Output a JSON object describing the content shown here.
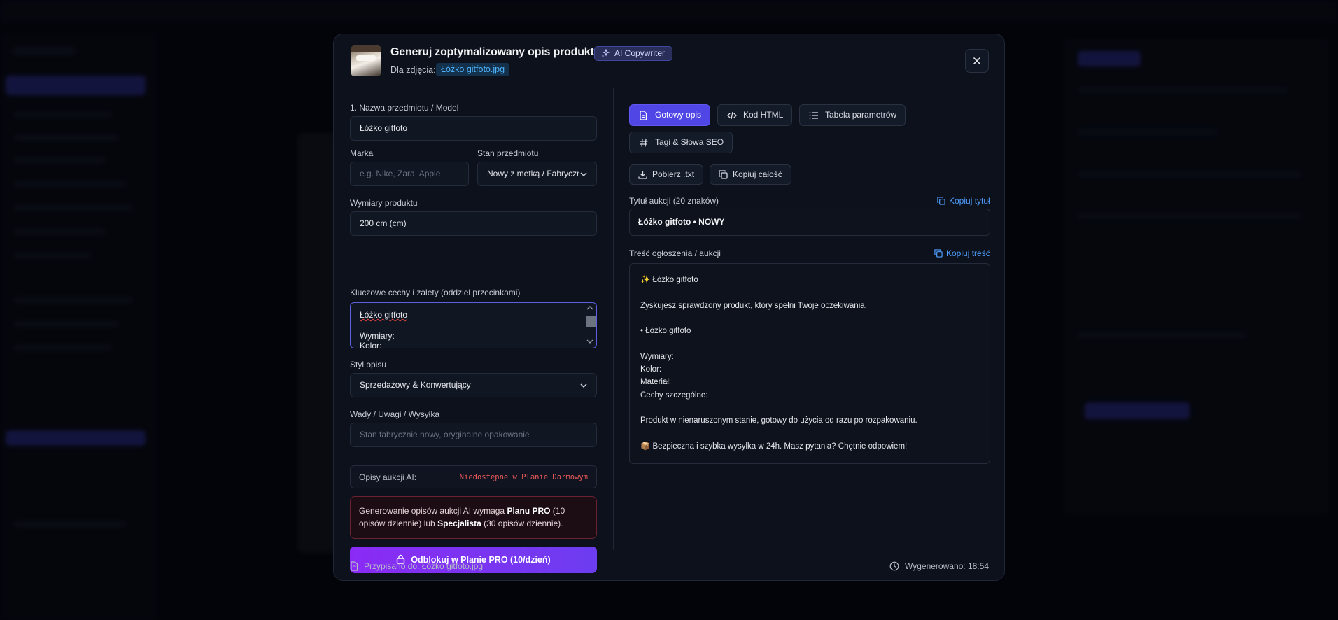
{
  "modal": {
    "title": "Generuj zoptymalizowany opis produktu",
    "badge": "AI Copywriter",
    "for_label": "Dla zdjęcia:",
    "file_name": "Łóżko gitfoto.jpg"
  },
  "form": {
    "name_label": "1. Nazwa przedmiotu / Model",
    "name_value": "Łóżko gitfoto",
    "brand_label": "Marka",
    "brand_placeholder": "e.g. Nike, Zara, Apple",
    "condition_label": "Stan przedmiotu",
    "condition_value": "Nowy z metką / Fabrycznie",
    "dims_label": "Wymiary produktu",
    "dims_value": "200 cm (cm)",
    "features_label": "Kluczowe cechy i zalety (oddziel przecinkami)",
    "features_line1": "Łóżko gitfoto",
    "features_line2": "Wymiary:",
    "features_line3": "Kolor:",
    "style_label": "Styl opisu",
    "style_value": "Sprzedażowy & Konwertujący",
    "defects_label": "Wady / Uwagi / Wysyłka",
    "defects_placeholder": "Stan fabrycznie nowy, oryginalne opakowanie",
    "ai_key": "Opisy aukcji AI:",
    "ai_value": "Niedostępne w Planie Darmowym",
    "warn_pre": "Generowanie opisów aukcji AI wymaga ",
    "warn_plan_pro": "Planu PRO",
    "warn_mid": " (10 opisów dziennie) lub ",
    "warn_plan_spec": "Specjalista",
    "warn_post": " (30 opisów dziennie).",
    "unlock_label": "Odblokuj w Planie PRO (10/dzień)"
  },
  "tabs": [
    {
      "label": "Gotowy opis"
    },
    {
      "label": "Kod HTML"
    },
    {
      "label": "Tabela parametrów"
    },
    {
      "label": "Tagi & Słowa SEO"
    }
  ],
  "actions": {
    "download": "Pobierz .txt",
    "copy_all": "Kopiuj całość"
  },
  "output": {
    "title_label": "Tytuł aukcji (20 znaków)",
    "copy_title": "Kopiuj tytuł",
    "title_value": "Łóżko gitfoto • NOWY",
    "desc_label": "Treść ogłoszenia / aukcji",
    "copy_desc": "Kopiuj treść",
    "desc_lines": [
      "✨ Łóżko gitfoto",
      "",
      "Zyskujesz sprawdzony produkt, który spełni Twoje oczekiwania.",
      "",
      "• Łóżko gitfoto",
      "",
      "Wymiary:",
      "Kolor:",
      "Materiał:",
      "Cechy szczególne:",
      "",
      "Produkt w nienaruszonym stanie, gotowy do użycia od razu po rozpakowaniu.",
      "",
      "📦 Bezpieczna i szybka wysyłka w 24h. Masz pytania? Chętnie odpowiem!"
    ]
  },
  "footer": {
    "assigned": "Przypisano do: Łóżko gitfoto.jpg",
    "generated": "Wygenerowano: 18:54"
  },
  "colors": {
    "accent": "#4f46e5",
    "unlock_gradient_start": "#8a2bf5",
    "error": "#f05a5a",
    "link": "#4f9dff"
  }
}
